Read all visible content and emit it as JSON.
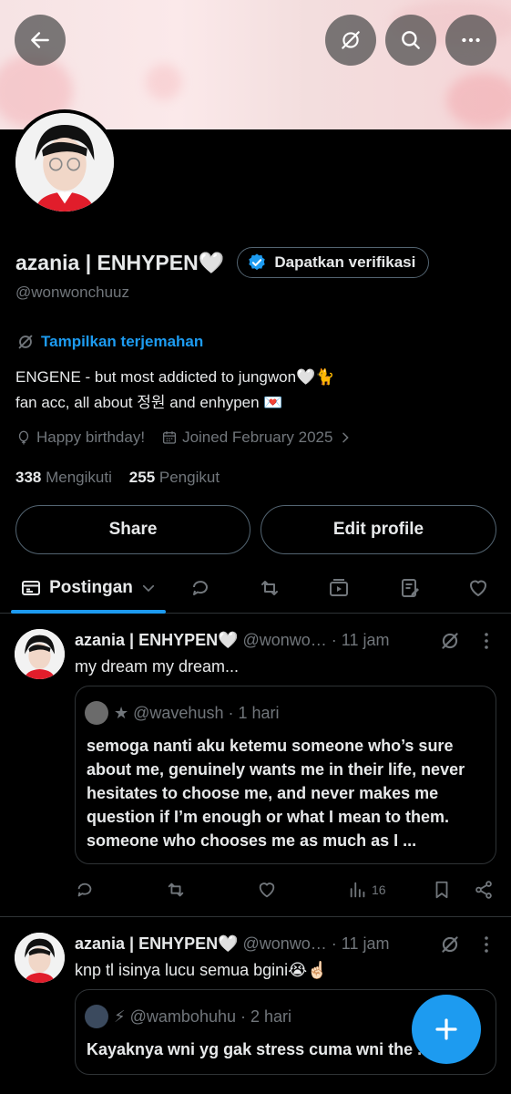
{
  "profile": {
    "name": "azania | ENHYPEN🤍",
    "handle": "@wonwonchuuz",
    "verify_label": "Dapatkan verifikasi",
    "translate_label": "Tampilkan terjemahan",
    "bio_line1": "ENGENE - but most addicted to jungwon🤍🐈",
    "bio_line2": "fan acc, all about 정원  and enhypen 💌",
    "birthday": "Happy birthday!",
    "joined": "Joined February 2025",
    "following_count": "338",
    "following_label": "Mengikuti",
    "followers_count": "255",
    "followers_label": "Pengikut",
    "share_label": "Share",
    "edit_label": "Edit profile"
  },
  "tabs": {
    "active_label": "Postingan"
  },
  "posts": [
    {
      "name": "azania | ENHYPEN🤍",
      "handle_time": "@wonwo… · 11 jam",
      "text": "my dream my dream...",
      "quote": {
        "head": "★ @wavehush · 1 hari",
        "body": "semoga nanti aku ketemu someone who’s sure about me, genuinely wants me in their life, never hesitates to choose me, and never makes me question if I’m enough or what I mean to them. someone who chooses me as much as I ..."
      },
      "views": "16"
    },
    {
      "name": "azania | ENHYPEN🤍",
      "handle_time": "@wonwo… · 11 jam",
      "text": "knp tl isinya lucu semua bgini😭☝🏻",
      "quote": {
        "head": "⚡ @wambohuhu · 2 hari",
        "body": "Kayaknya wni yg gak stress cuma wni the ... n"
      }
    }
  ],
  "colors": {
    "accent": "#1d9bf0",
    "muted": "#71767b",
    "border": "#2f3336"
  }
}
